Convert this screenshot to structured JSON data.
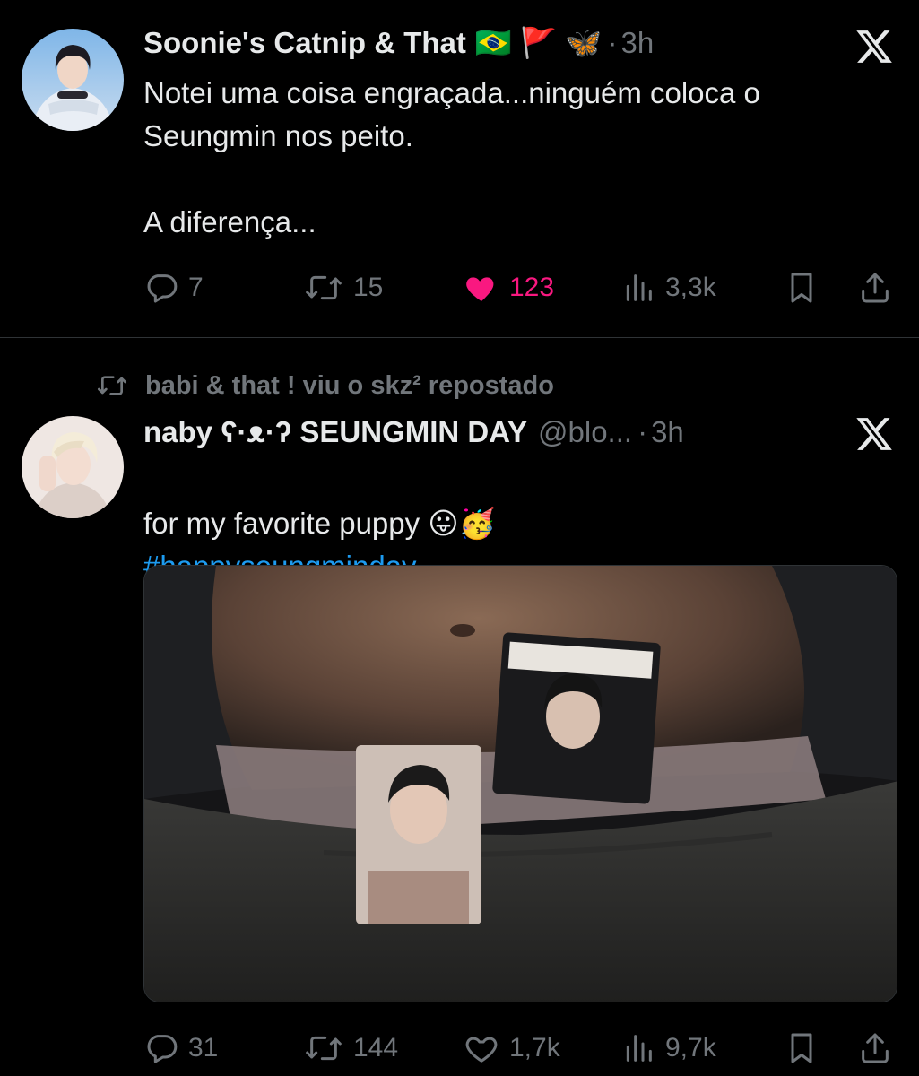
{
  "tweets": [
    {
      "display_name": "Soonie's Catnip & That",
      "flags": "🇧🇷 🚩 🦋",
      "dot": "·",
      "time": "3h",
      "text": "Notei uma coisa engraçada...ninguém coloca o\nSeungmin nos peito.\n\nA diferença...",
      "replies": "7",
      "reposts": "15",
      "likes": "123",
      "liked": true,
      "views": "3,3k",
      "avatar_icon": "avatar-photo"
    },
    {
      "repost_label": "babi & that ! viu o skz² repostado",
      "display_name": "naby ʕ·ᴥ·ʔ SEUNGMIN DAY",
      "handle": "@blo...",
      "dot": "·",
      "time": "3h",
      "text": "for my favorite puppy 😛🥳",
      "hashtag": "#happyseungminday",
      "replies": "31",
      "reposts": "144",
      "likes": "1,7k",
      "liked": false,
      "views": "9,7k",
      "avatar_icon": "avatar-photo"
    }
  ],
  "colors": {
    "background": "#000000",
    "text": "#e7e9ea",
    "muted": "#71767b",
    "like": "#f91880",
    "link": "#1d9bf0",
    "divider": "#2f3336"
  }
}
